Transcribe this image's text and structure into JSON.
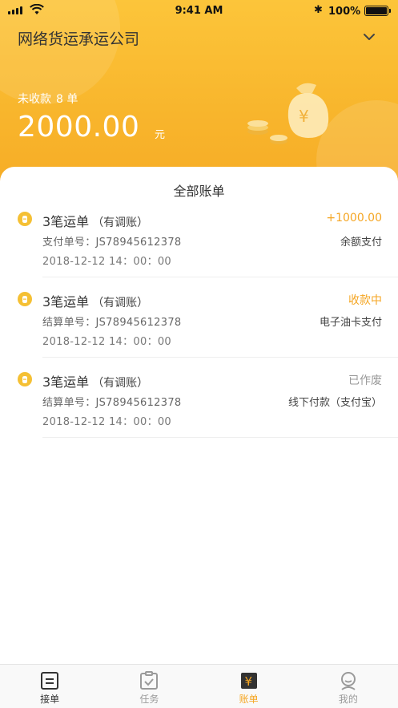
{
  "status_bar": {
    "time": "9:41 AM",
    "battery": "100%"
  },
  "header": {
    "company": "网络货运承运公司",
    "unpaid_label": "未收款",
    "unpaid_count": "8 单",
    "amount": "2000.00",
    "amount_unit": "元"
  },
  "section_title": "全部账单",
  "bills": [
    {
      "title": "3笔运单",
      "note": "（有调账）",
      "status": "+1000.00",
      "status_color": "#f5a623",
      "number_line": "支付单号：JS78945612378",
      "method": "余额支付",
      "date": "2018-12-12 14：00：00"
    },
    {
      "title": "3笔运单",
      "note": "（有调账）",
      "status": "收款中",
      "status_color": "#f5a623",
      "number_line": "结算单号：JS78945612378",
      "method": "电子油卡支付",
      "date": "2018-12-12 14：00：00"
    },
    {
      "title": "3笔运单",
      "note": "（有调账）",
      "status": "已作废",
      "status_color": "#999999",
      "number_line": "结算单号：JS78945612378",
      "method": "线下付款（支付宝）",
      "date": "2018-12-12 14：00：00"
    }
  ],
  "tabs": [
    {
      "label": "接单",
      "icon": "order-list-icon"
    },
    {
      "label": "任务",
      "icon": "task-clipboard-icon"
    },
    {
      "label": "账单",
      "icon": "bill-yen-icon",
      "active": true
    },
    {
      "label": "我的",
      "icon": "profile-icon"
    }
  ],
  "colors": {
    "accent": "#f5a623",
    "header": "#f8b52c"
  }
}
